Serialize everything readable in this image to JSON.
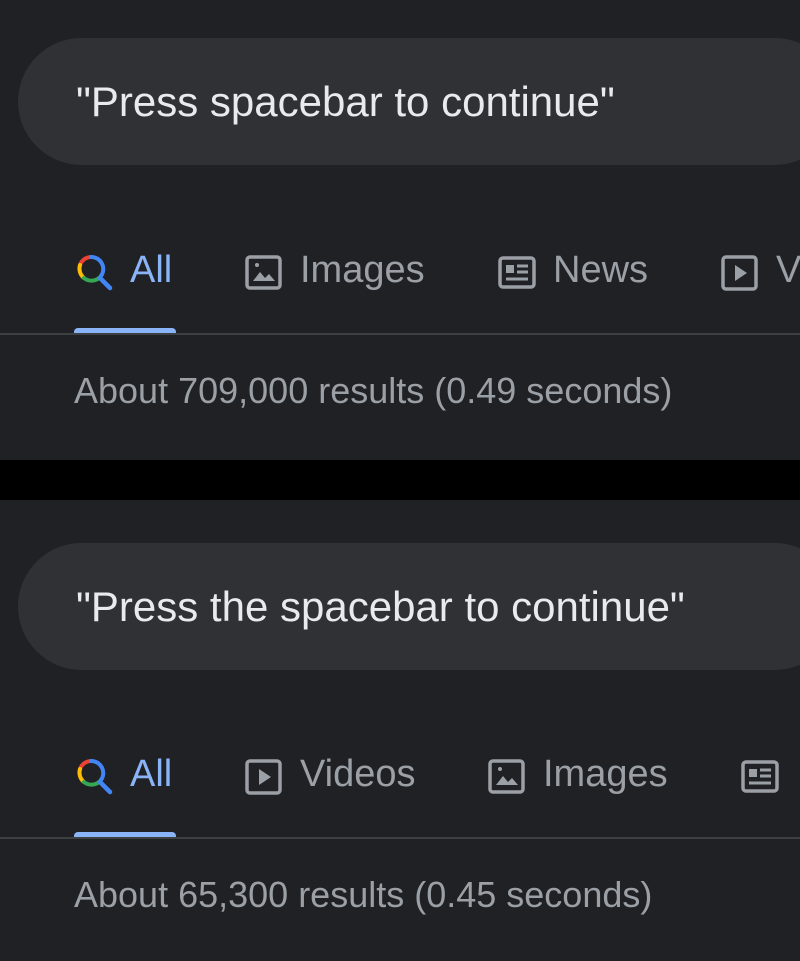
{
  "panels": [
    {
      "query": "\"Press spacebar to continue\"",
      "tabs": [
        {
          "label": "All",
          "icon": "search-icon",
          "active": true
        },
        {
          "label": "Images",
          "icon": "image-icon",
          "active": false
        },
        {
          "label": "News",
          "icon": "news-icon",
          "active": false
        },
        {
          "label": "V",
          "icon": "video-icon",
          "active": false
        }
      ],
      "stats": "About 709,000 results (0.49 seconds)"
    },
    {
      "query": "\"Press the spacebar to continue\"",
      "tabs": [
        {
          "label": "All",
          "icon": "search-icon",
          "active": true
        },
        {
          "label": "Videos",
          "icon": "video-icon",
          "active": false
        },
        {
          "label": "Images",
          "icon": "image-icon",
          "active": false
        },
        {
          "label": "",
          "icon": "news-icon",
          "active": false
        }
      ],
      "stats": "About 65,300 results (0.45 seconds)"
    }
  ],
  "colors": {
    "background": "#202124",
    "separator": "#000000",
    "search_box": "#303134",
    "query_text": "#e8eaed",
    "tab_text": "#9aa0a6",
    "active_tab": "#8ab4f8",
    "divider": "#3c4043"
  }
}
